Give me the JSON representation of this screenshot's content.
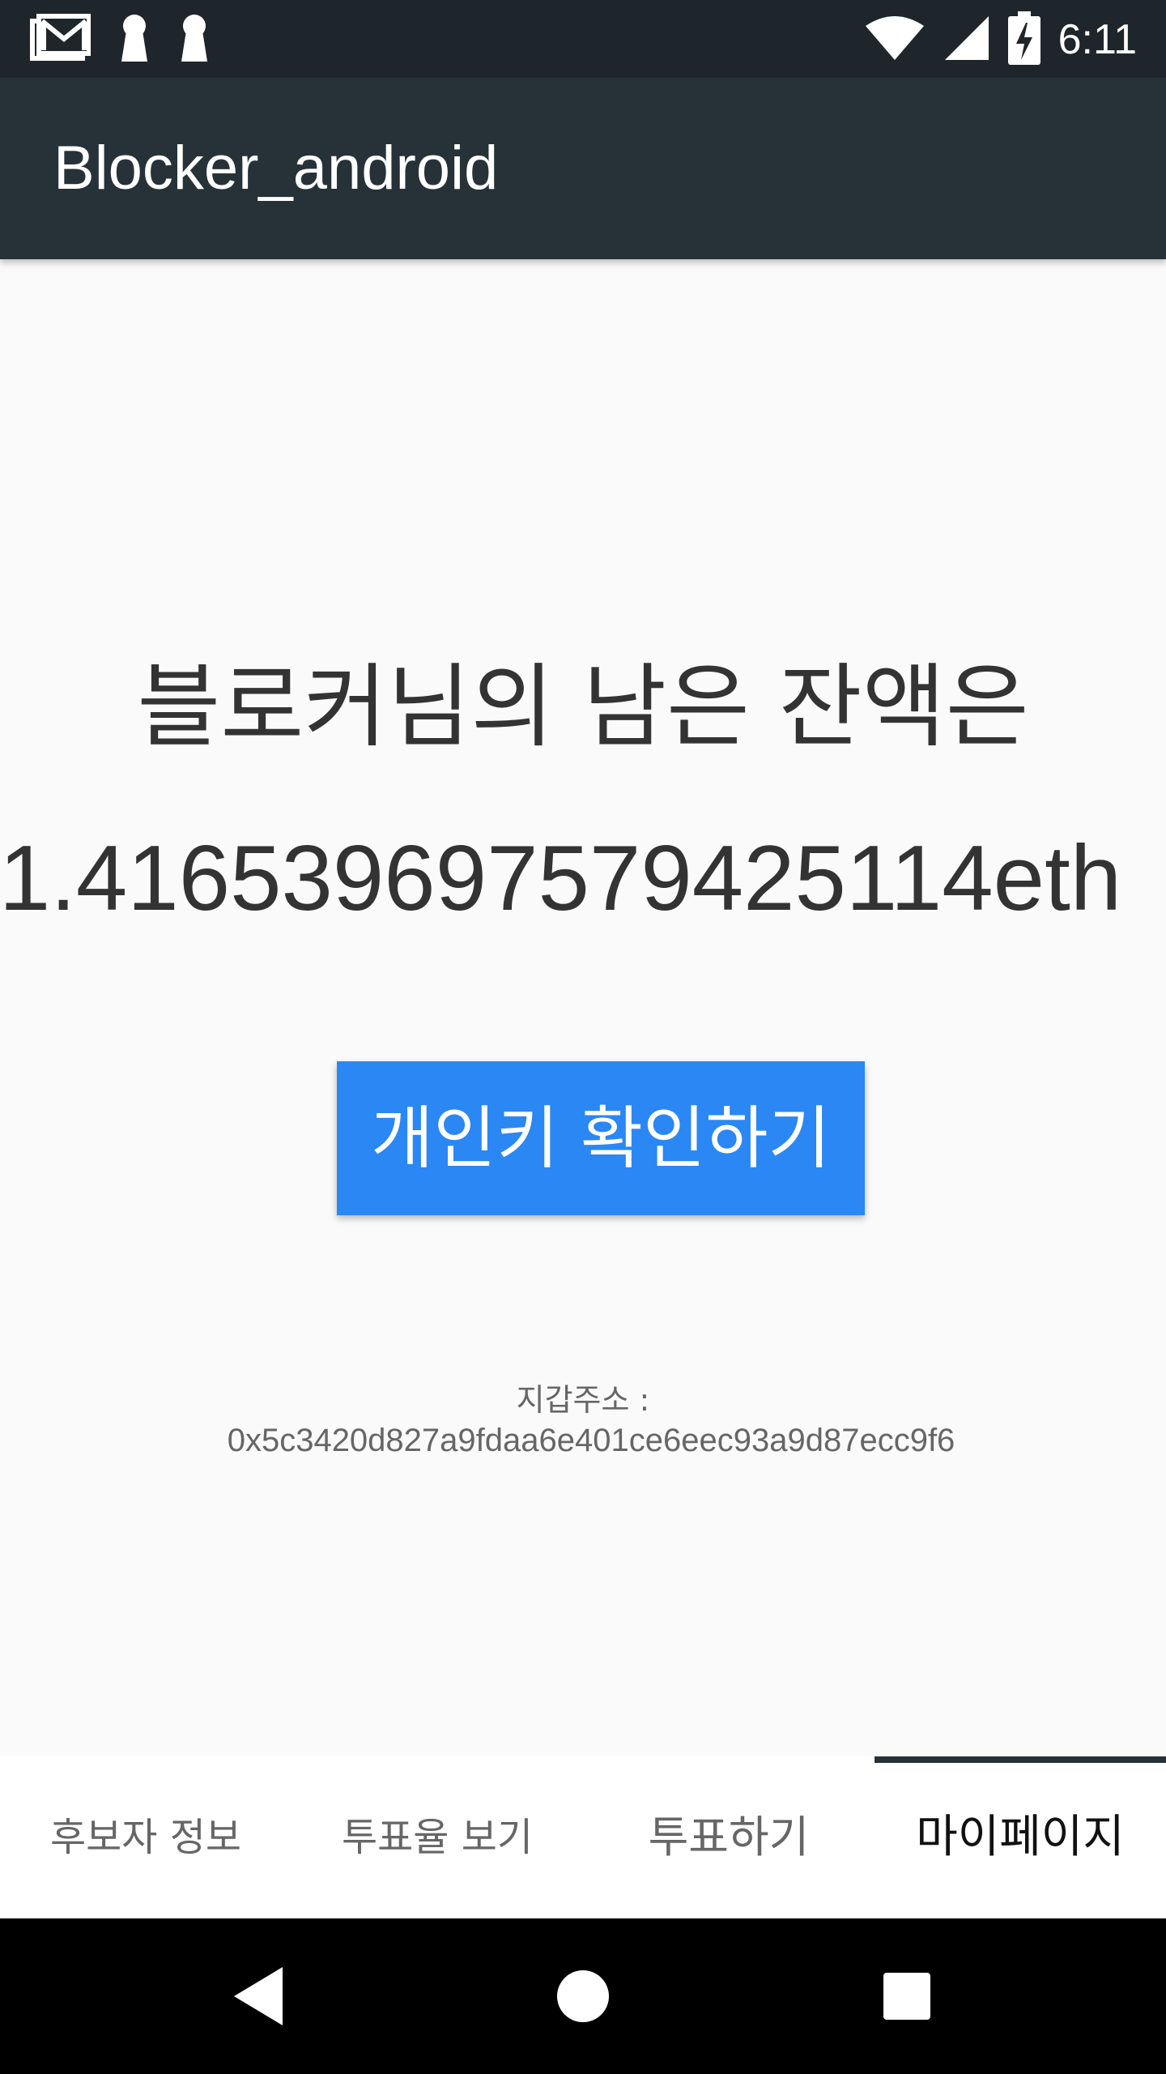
{
  "status_bar": {
    "time": "6:11",
    "left_icons": [
      "gmail-icon",
      "keyhole-icon",
      "keyhole-icon"
    ],
    "right_icons": [
      "wifi-icon",
      "cellular-signal-icon",
      "battery-charging-icon"
    ]
  },
  "app_bar": {
    "title": "Blocker_android"
  },
  "main": {
    "balance_heading": "블로커님의 남은 잔액은",
    "balance_value": "1.416539697579425114eth",
    "privkey_button_label": "개인키 확인하기",
    "wallet_label": "지갑주소 :",
    "wallet_address": "0x5c3420d827a9fdaa6e401ce6eec93a9d87ecc9f6"
  },
  "tabs": [
    {
      "label": "후보자 정보",
      "active": false
    },
    {
      "label": "투표율 보기",
      "active": false
    },
    {
      "label": "투표하기",
      "active": false
    },
    {
      "label": "마이페이지",
      "active": true
    }
  ],
  "nav_bar": {
    "icons": [
      "back-icon",
      "home-icon",
      "recents-icon"
    ]
  },
  "colors": {
    "status_bar": "#1f262b",
    "app_bar": "#263238",
    "accent_button": "#2a87f4",
    "background": "#fafafa",
    "tab_indicator": "#263238"
  }
}
